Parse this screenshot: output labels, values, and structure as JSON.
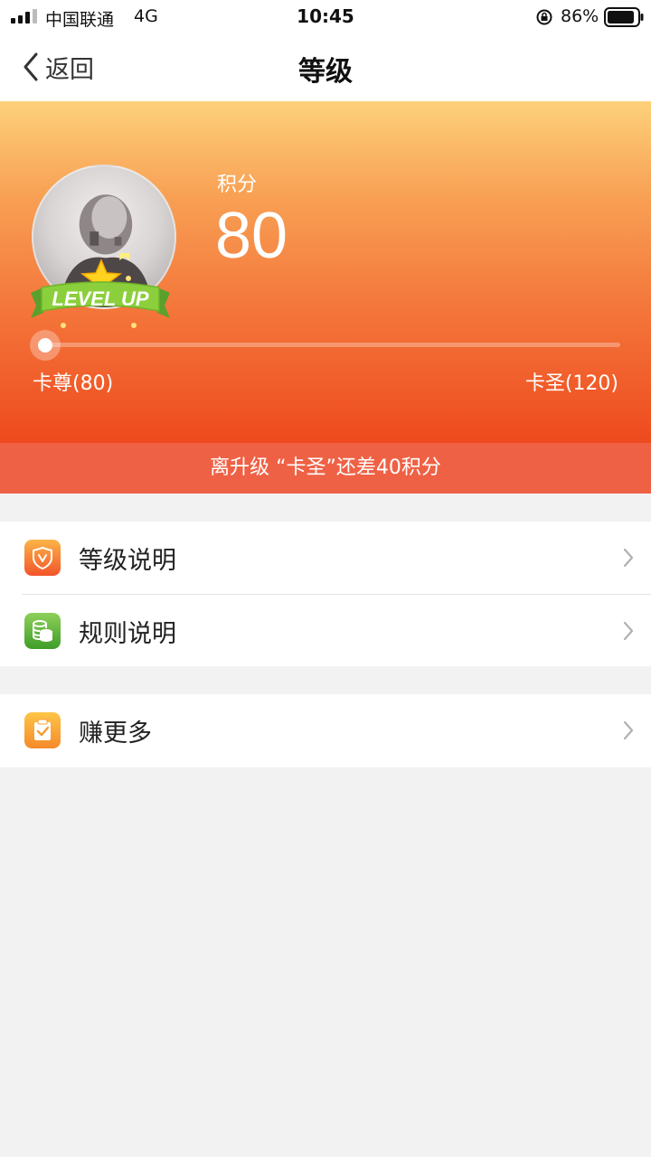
{
  "status_bar": {
    "carrier": "中国联通",
    "network": "4G",
    "time": "10:45",
    "battery": "86%"
  },
  "nav": {
    "back_label": "返回",
    "title": "等级"
  },
  "hero": {
    "points_label": "积分",
    "points_value": "80",
    "badge_text": "LEVEL UP",
    "current_level": "卡尊(80)",
    "next_level": "卡圣(120)",
    "progress": 0.0,
    "upgrade_message": "离升级 “卡圣”还差40积分"
  },
  "menu": {
    "level_info": "等级说明",
    "rules_info": "规则说明",
    "earn_more": "赚更多"
  },
  "colors": {
    "hero_top": "#fdd17a",
    "hero_bottom": "#ee4a1e",
    "banner": "#ef6145"
  }
}
